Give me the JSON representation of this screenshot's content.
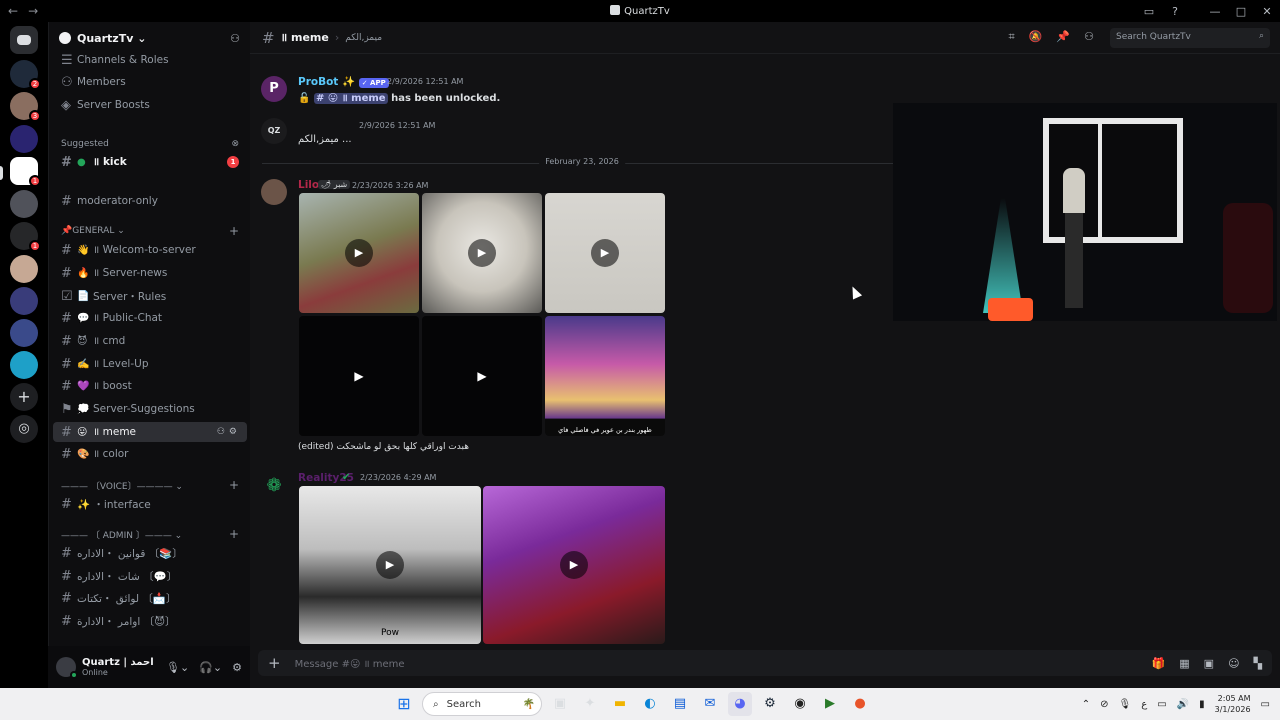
{
  "window": {
    "title": "QuartzTv",
    "nav_back": "←",
    "nav_fwd": "→"
  },
  "sidebar": {
    "guild_name": "QuartzTv ⌄",
    "channels_roles": "Channels & Roles",
    "members": "Members",
    "server_boosts": "Server Boosts",
    "suggested_label": "Suggested",
    "suggested_channel": "॥ kick",
    "suggested_count": "1",
    "moderator_only": "moderator-only",
    "cat_general": "📌GENERAL ⌄",
    "items": [
      {
        "emoji": "👋",
        "label": "॥ Welcom-to-server"
      },
      {
        "emoji": "🔥",
        "label": "॥ Server-news"
      },
      {
        "emoji": "📄",
        "label": "Server・Rules"
      },
      {
        "emoji": "💬",
        "label": "॥ Public-Chat"
      },
      {
        "emoji": "😈",
        "label": "॥ cmd"
      },
      {
        "emoji": "✍️",
        "label": "॥ Level-Up"
      },
      {
        "emoji": "💜",
        "label": "॥ boost"
      },
      {
        "emoji": "💭",
        "label": "Server-Suggestions"
      },
      {
        "emoji": "😛",
        "label": "॥ meme"
      },
      {
        "emoji": "🎨",
        "label": "॥ color"
      }
    ],
    "cat_voice": "——— 〔VOICE〕———— ⌄",
    "voice_interface": "✨ ・interface",
    "cat_admin": "——— 〔 ADMIN 〕——— ⌄",
    "admin_items": [
      "قوانين ・الاداره 〔📚〕",
      "شات ・الاداره 〔💬〕",
      "لوائق ・تكتات 〔📩〕",
      "اوامر ・الادارة 〔😈〕"
    ]
  },
  "user_panel": {
    "name": "Quartz | احمد",
    "status": "Online"
  },
  "header": {
    "channel": "॥ meme",
    "topic": "ميمز,الكم",
    "search_placeholder": "Search QuartzTv"
  },
  "messages": {
    "probot_name": "ProBot ✨",
    "probot_tag": "✓ APP",
    "probot_time": "2/9/2026 12:51 AM",
    "probot_text_channel": "# 😛 ॥ meme",
    "probot_text_rest": "has been unlocked.",
    "second_time": "2/9/2026 12:51 AM",
    "second_text": "ميمز,الكم ...",
    "date_divider": "February 23, 2026",
    "lilo_name": "Lilo",
    "lilo_badge": "🌶 شبر",
    "lilo_time": "2/23/2026 3:26 AM",
    "lilo_caption": "(edited) هبدت اوراقي كلها بحق لو ماشحكت",
    "tile_caption": "ظهور بندر بن عوير في فاصلي فاي",
    "reality_name": "Reality25",
    "reality_time": "2/23/2026 4:29 AM",
    "row_text": "Pow"
  },
  "composer": {
    "placeholder": "Message #😛 ॥ meme"
  },
  "taskbar": {
    "search": "Search",
    "time": "2:05 AM",
    "date": "3/1/2026",
    "lang": "ع"
  },
  "colors": {
    "accent": "#5865f2",
    "online": "#23a55a",
    "danger": "#f23f43",
    "probot": "#ffffff",
    "lilo": "#b22849",
    "reality": "#5a1f6b"
  }
}
